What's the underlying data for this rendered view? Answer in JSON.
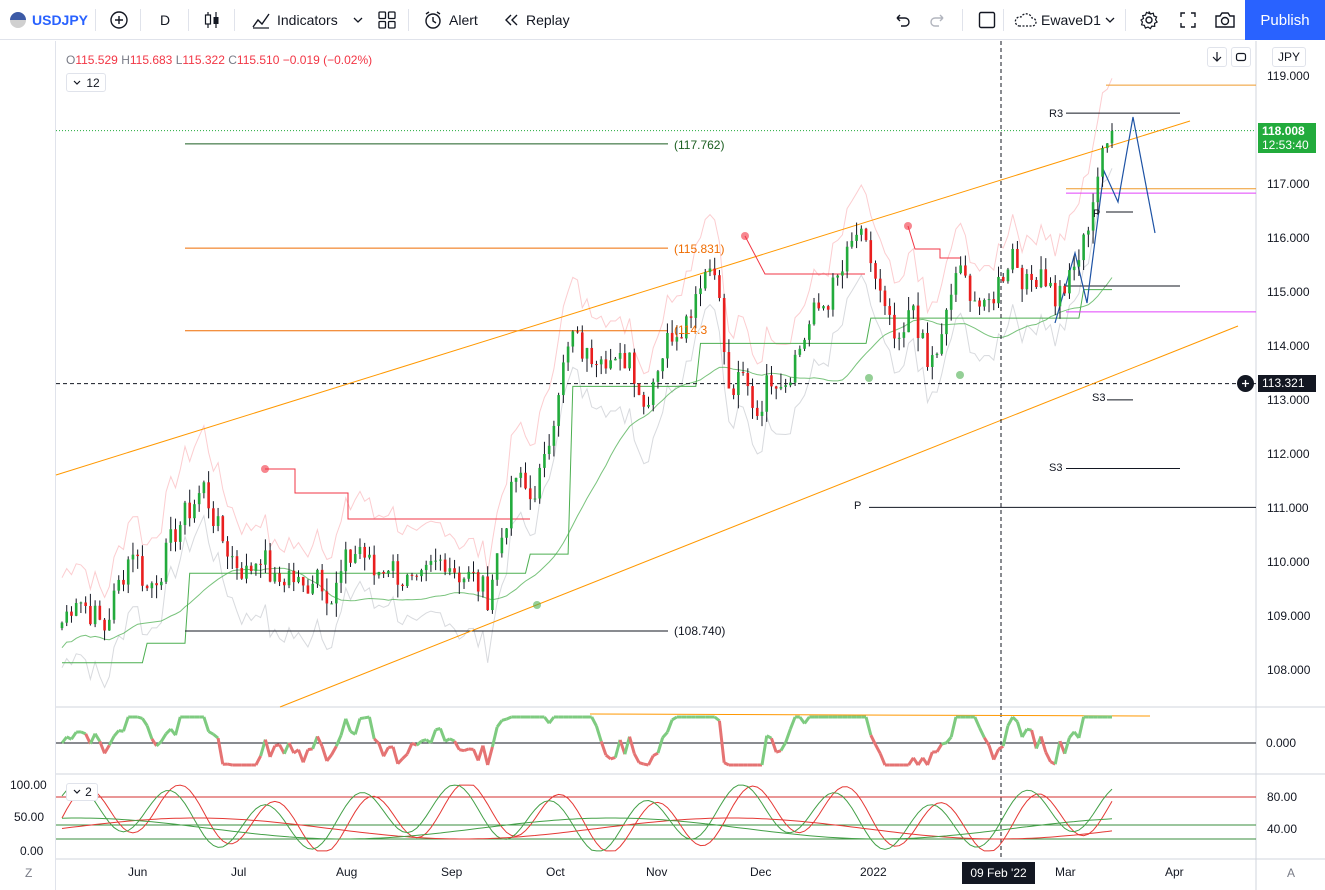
{
  "toolbar": {
    "symbol": "USDJPY",
    "interval": "D",
    "indicators_label": "Indicators",
    "alert_label": "Alert",
    "replay_label": "Replay",
    "layout_name": "EwaveD1",
    "publish_label": "Publish"
  },
  "legend": {
    "open_key": "O",
    "open": "115.529",
    "high_key": "H",
    "high": "115.683",
    "low_key": "L",
    "low": "115.322",
    "close_key": "C",
    "close": "115.510",
    "change": "−0.019 (−0.02%)",
    "indicator_count": "12",
    "osc_count": "2"
  },
  "price_axis": {
    "currency": "JPY",
    "ticks": [
      "119.000",
      "118.000",
      "117.000",
      "116.000",
      "115.000",
      "114.000",
      "113.000",
      "112.000",
      "111.000",
      "110.000",
      "109.000",
      "108.000"
    ],
    "current_price": "118.008",
    "countdown": "12:53:40",
    "crosshair_price": "113.321"
  },
  "osc_axis": {
    "zero_tick": "0.000"
  },
  "stoch_axis": {
    "left_ticks": [
      "100.00",
      "50.00",
      "0.00"
    ],
    "right_ticks": [
      "80.00",
      "40.00"
    ]
  },
  "time_axis": {
    "labels": [
      "Jun",
      "Jul",
      "Aug",
      "Sep",
      "Oct",
      "Nov",
      "Dec",
      "2022",
      "Mar",
      "Apr"
    ],
    "crosshair_date": "09 Feb '22",
    "left_btn": "Z",
    "right_btn": "A"
  },
  "levels": {
    "l1": "(117.762)",
    "l2": "(115.831)",
    "l3": "(114.3",
    "l4": "(108.740)",
    "r3": "R3",
    "p_small": "P",
    "s3_a": "S3",
    "s3_b": "S3",
    "p_big": "P"
  },
  "colors": {
    "accent": "#2962ff",
    "up": "#089981",
    "candle_up": "#22ab3c",
    "candle_down": "#e91e1e",
    "channel": "#ff9800",
    "ma_green": "#4caf50",
    "resistance": "#f23645",
    "fib": "#e040fb"
  },
  "chart_data": {
    "type": "candlestick",
    "symbol": "USDJPY",
    "interval": "D",
    "y_range": [
      107.3,
      119.3
    ],
    "x_months": [
      "Jun",
      "Jul",
      "Aug",
      "Sep",
      "Oct",
      "Nov",
      "Dec",
      "2022",
      "Mar",
      "Apr"
    ],
    "close_path": [
      108.9,
      109.4,
      109.1,
      108.8,
      109.6,
      110.3,
      109.5,
      109.9,
      110.6,
      111.0,
      111.4,
      110.6,
      110.1,
      109.8,
      110.2,
      109.6,
      109.8,
      109.5,
      109.9,
      109.3,
      110.0,
      110.3,
      109.8,
      110.0,
      109.7,
      109.5,
      109.9,
      110.1,
      109.8,
      109.7,
      109.4,
      110.5,
      111.6,
      111.2,
      111.8,
      113.3,
      114.2,
      113.8,
      114.0,
      113.6,
      113.9,
      112.9,
      113.7,
      114.3,
      114.5,
      115.3,
      115.6,
      113.1,
      113.4,
      112.8,
      113.5,
      113.4,
      114.0,
      114.6,
      114.9,
      115.4,
      116.1,
      115.6,
      114.6,
      113.9,
      114.8,
      113.6,
      114.1,
      115.4,
      115.1,
      114.6,
      115.2,
      115.8,
      115.1,
      115.5,
      114.9,
      115.2,
      115.9,
      117.2,
      118.0
    ],
    "annotations": {
      "levels": [
        117.762,
        115.831,
        114.3,
        108.74
      ],
      "current": 118.008,
      "crosshair": 113.321
    }
  }
}
